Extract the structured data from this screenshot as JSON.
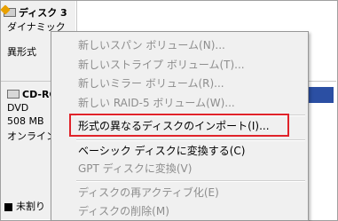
{
  "disk3": {
    "title": "ディスク 3",
    "type": "ダイナミック",
    "status": "異形式"
  },
  "cdrom": {
    "title": "CD-RO",
    "type": "DVD",
    "size": "508 MB",
    "status": "オンライン"
  },
  "legend": {
    "unallocated": "未割り"
  },
  "context_menu": {
    "items": [
      {
        "label": "新しいスパン ボリューム(N)...",
        "enabled": false
      },
      {
        "label": "新しいストライプ ボリューム(T)...",
        "enabled": false
      },
      {
        "label": "新しいミラー ボリューム(R)...",
        "enabled": false
      },
      {
        "label": "新しい RAID-5 ボリューム(W)...",
        "enabled": false
      },
      {
        "label": "形式の異なるディスクのインポート(I)...",
        "enabled": true,
        "highlighted": true
      },
      {
        "label": "ベーシック ディスクに変換する(C)",
        "enabled": true
      },
      {
        "label": "GPT ディスクに変換(V)",
        "enabled": false
      },
      {
        "label": "ディスクの再アクティブ化(E)",
        "enabled": false
      },
      {
        "label": "ディスクの削除(M)",
        "enabled": false
      }
    ]
  },
  "colors": {
    "highlight_border": "#e0232a",
    "volume_bar": "#2b4fa3"
  }
}
